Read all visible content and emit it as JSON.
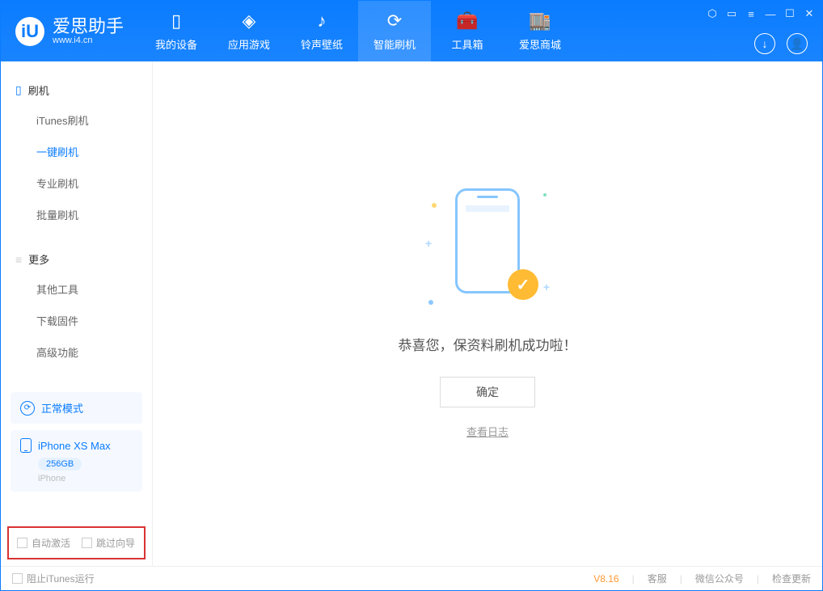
{
  "header": {
    "app_name": "爱思助手",
    "app_url": "www.i4.cn",
    "tabs": [
      {
        "label": "我的设备"
      },
      {
        "label": "应用游戏"
      },
      {
        "label": "铃声壁纸"
      },
      {
        "label": "智能刷机"
      },
      {
        "label": "工具箱"
      },
      {
        "label": "爱思商城"
      }
    ]
  },
  "sidebar": {
    "section1_title": "刷机",
    "section1_items": [
      "iTunes刷机",
      "一键刷机",
      "专业刷机",
      "批量刷机"
    ],
    "section2_title": "更多",
    "section2_items": [
      "其他工具",
      "下载固件",
      "高级功能"
    ],
    "mode_label": "正常模式",
    "device_name": "iPhone XS Max",
    "device_storage": "256GB",
    "device_type": "iPhone",
    "check_auto_activate": "自动激活",
    "check_skip_guide": "跳过向导"
  },
  "main": {
    "success_text": "恭喜您，保资料刷机成功啦！",
    "ok_button": "确定",
    "view_log": "查看日志"
  },
  "footer": {
    "block_itunes": "阻止iTunes运行",
    "version": "V8.16",
    "links": [
      "客服",
      "微信公众号",
      "检查更新"
    ]
  }
}
